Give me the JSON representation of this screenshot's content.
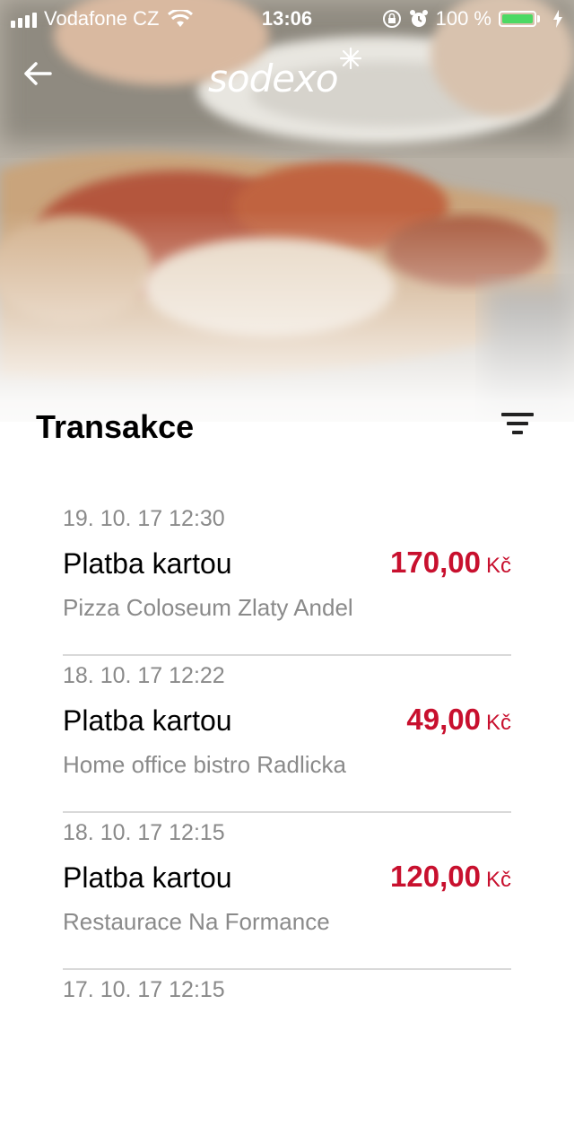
{
  "status_bar": {
    "carrier": "Vodafone CZ",
    "time": "13:06",
    "battery_text": "100 %",
    "battery_level": 1.0,
    "icons": [
      "signal-icon",
      "wifi-icon",
      "orientation-lock-icon",
      "alarm-icon",
      "battery-icon",
      "charging-bolt-icon"
    ]
  },
  "header": {
    "logo_text": "sodexo",
    "back_icon": "back-arrow-icon"
  },
  "page": {
    "title": "Transakce",
    "filter_icon": "filter-icon"
  },
  "transactions": [
    {
      "date": "19. 10. 17 12:30",
      "type": "Platba kartou",
      "amount": "170,00",
      "currency": "Kč",
      "merchant": "Pizza Coloseum Zlaty Andel"
    },
    {
      "date": "18. 10. 17 12:22",
      "type": "Platba kartou",
      "amount": "49,00",
      "currency": "Kč",
      "merchant": "Home office bistro Radlicka"
    },
    {
      "date": "18. 10. 17 12:15",
      "type": "Platba kartou",
      "amount": "120,00",
      "currency": "Kč",
      "merchant": "Restaurace Na Formance"
    },
    {
      "date": "17. 10. 17 12:15"
    }
  ],
  "colors": {
    "accent": "#c8102e",
    "secondary_text": "#8a8a8a",
    "battery_green": "#4cd964"
  }
}
